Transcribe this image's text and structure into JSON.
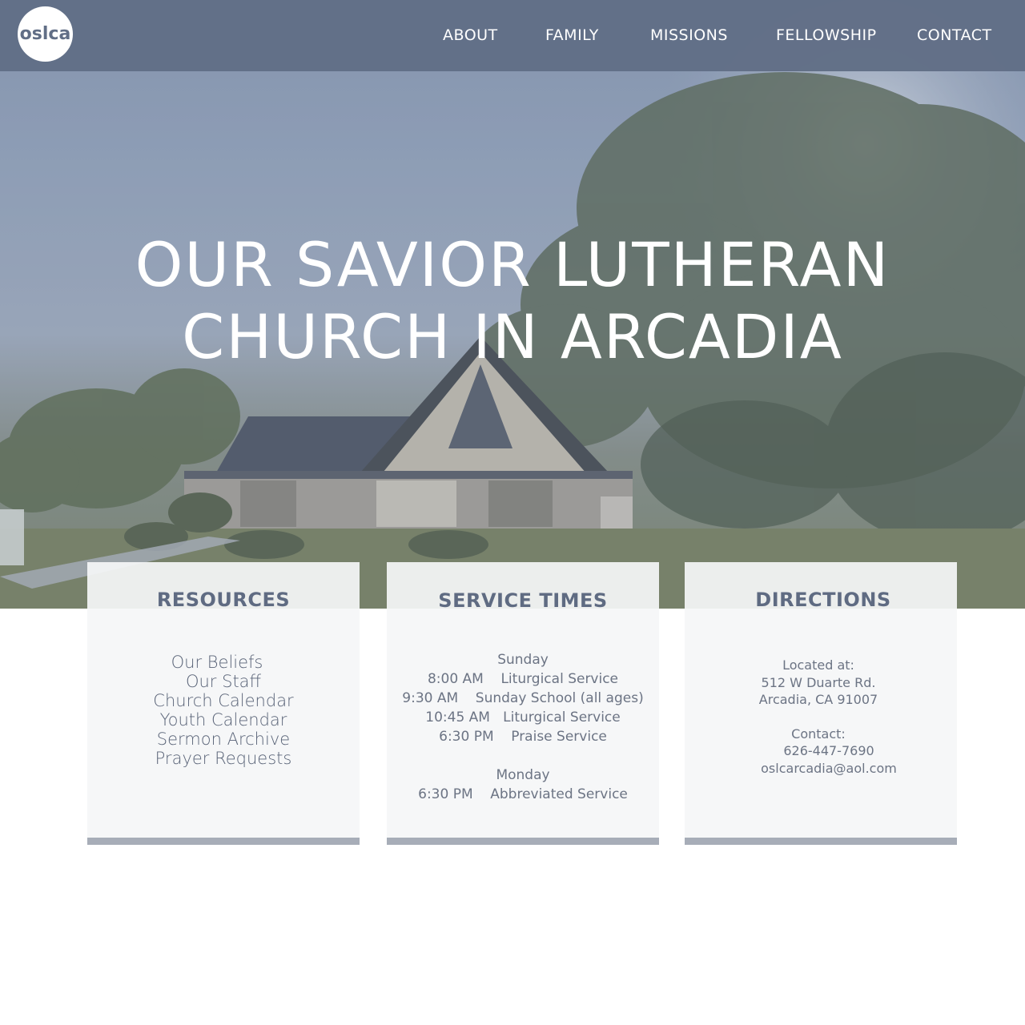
{
  "header": {
    "logo_text": "oslca",
    "nav": [
      "ABOUT",
      "FAMILY",
      "MISSIONS",
      "FELLOWSHIP",
      "CONTACT"
    ]
  },
  "hero": {
    "title_line1": "OUR SAVIOR LUTHERAN",
    "title_line2": "CHURCH IN ARCADIA"
  },
  "resources": {
    "title": "RESOURCES",
    "links": [
      "Our Beliefs",
      "Our Staff",
      "Church Calendar",
      "Youth Calendar",
      "Sermon Archive",
      "Prayer Requests"
    ]
  },
  "service_times": {
    "title": "SERVICE TIMES",
    "sunday_label": "Sunday",
    "sunday_items": [
      "8:00 AM    Liturgical Service",
      "9:30 AM    Sunday School (all ages)",
      "10:45 AM   Liturgical Service",
      "6:30 PM    Praise Service"
    ],
    "monday_label": "Monday",
    "monday_items": [
      "6:30 PM    Abbreviated Service"
    ]
  },
  "directions": {
    "title": "DIRECTIONS",
    "located_label": "Located at:",
    "address_line1": "512 W Duarte Rd.",
    "address_line2": "Arcadia, CA 91007",
    "contact_label": "Contact:",
    "phone": "626-447-7690",
    "email": "oslcarcadia@aol.com"
  }
}
